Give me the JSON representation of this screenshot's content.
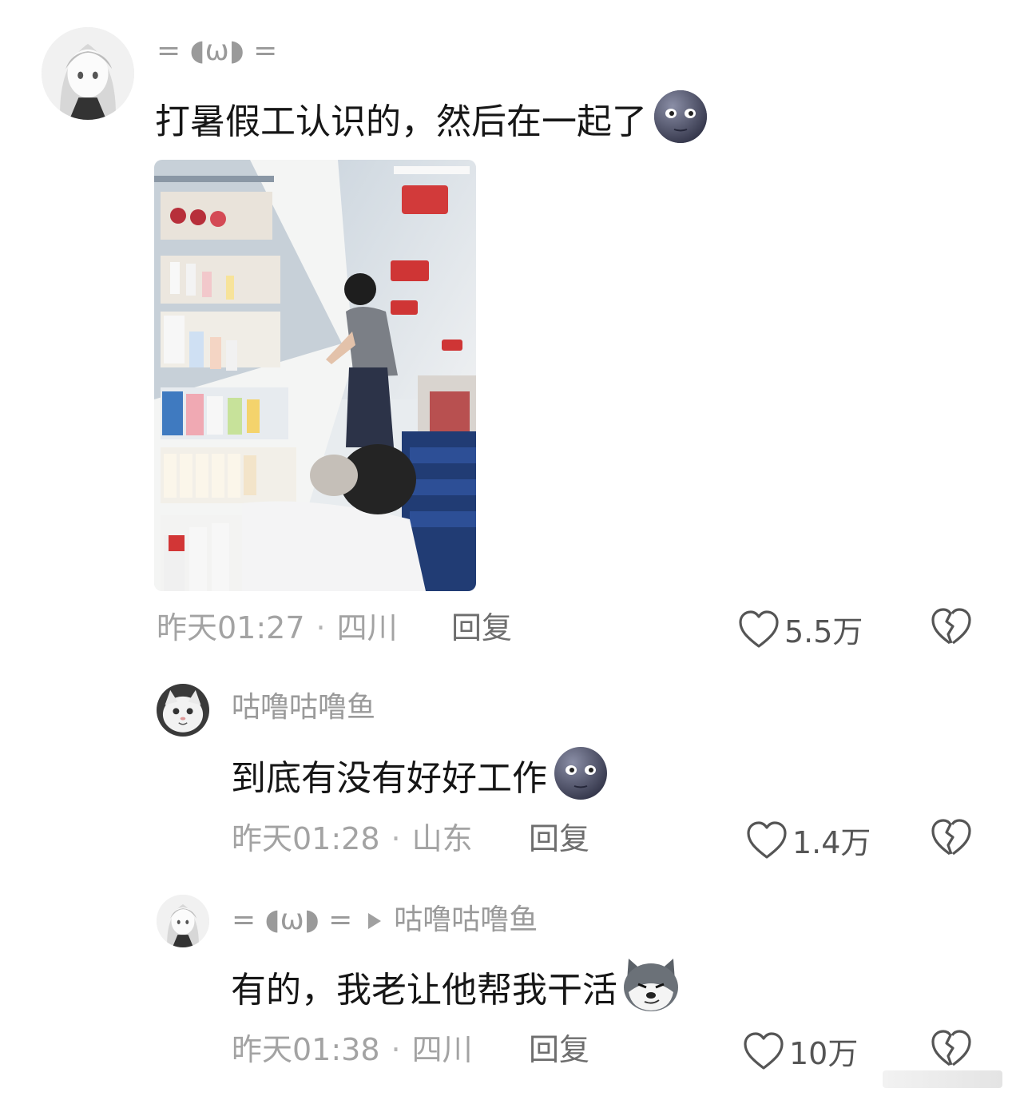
{
  "comments": [
    {
      "username": "= ◖ω◗ =",
      "text": "打暑假工认识的，然后在一起了",
      "emoji": "moon-face-emoji",
      "time": "昨天01:27",
      "location": "四川",
      "reply_label": "回复",
      "likes": "5.5万"
    },
    {
      "username": "咕噜咕噜鱼",
      "text": "到底有没有好好工作",
      "emoji": "moon-face-emoji",
      "time": "昨天01:28",
      "location": "山东",
      "reply_label": "回复",
      "likes": "1.4万"
    },
    {
      "username": "= ◖ω◗ =",
      "reply_to": "咕噜咕噜鱼",
      "text": "有的，我老让他帮我干活",
      "emoji": "husky-dog-emoji",
      "time": "昨天01:38",
      "location": "四川",
      "reply_label": "回复",
      "likes": "10万"
    }
  ],
  "colors": {
    "text": "#161616",
    "meta": "#a3a3a3",
    "username": "#9a9a9a"
  }
}
